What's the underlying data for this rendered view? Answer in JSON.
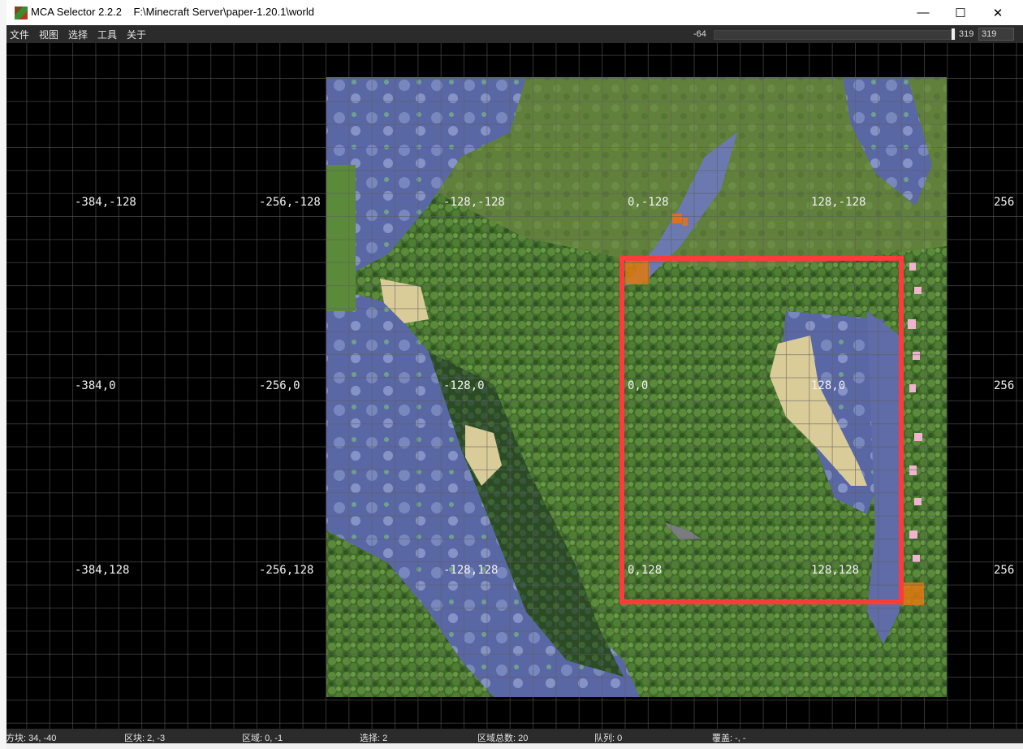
{
  "titlebar": {
    "app_name": "MCA Selector 2.2.2",
    "world_path": "F:\\Minecraft Server\\paper-1.20.1\\world",
    "minimize_glyph": "—",
    "maximize_glyph": "☐",
    "close_glyph": "✕"
  },
  "menu": [
    "文件",
    "视图",
    "选择",
    "工具",
    "关于"
  ],
  "height_slider": {
    "min_label": "-64",
    "max_label": "319",
    "value": "319",
    "fraction": 1.0
  },
  "map": {
    "coord_labels": [
      {
        "text": "-384,-128"
      },
      {
        "text": "-256,-128"
      },
      {
        "text": "-128,-128"
      },
      {
        "text": "0,-128"
      },
      {
        "text": "128,-128"
      },
      {
        "text": "256"
      },
      {
        "text": "-384,0"
      },
      {
        "text": "-256,0"
      },
      {
        "text": "-128,0"
      },
      {
        "text": "0,0"
      },
      {
        "text": "128,0"
      },
      {
        "text": "256"
      },
      {
        "text": "-384,128"
      },
      {
        "text": "-256,128"
      },
      {
        "text": "-128,128"
      },
      {
        "text": "0,128"
      },
      {
        "text": "128,128"
      },
      {
        "text": "256"
      }
    ],
    "selection_color": "#ff3a3a",
    "chunk_highlight_color": "#ff7a00",
    "grid_color": "#5e5e5e"
  },
  "status": {
    "block": "方块: 34, -40",
    "chunk": "区块: 2, -3",
    "region": "区域: 0, -1",
    "selected": "选择: 2",
    "total_regions": "区域总数: 20",
    "queue": "队列: 0",
    "overlay": "覆盖: -, -"
  }
}
